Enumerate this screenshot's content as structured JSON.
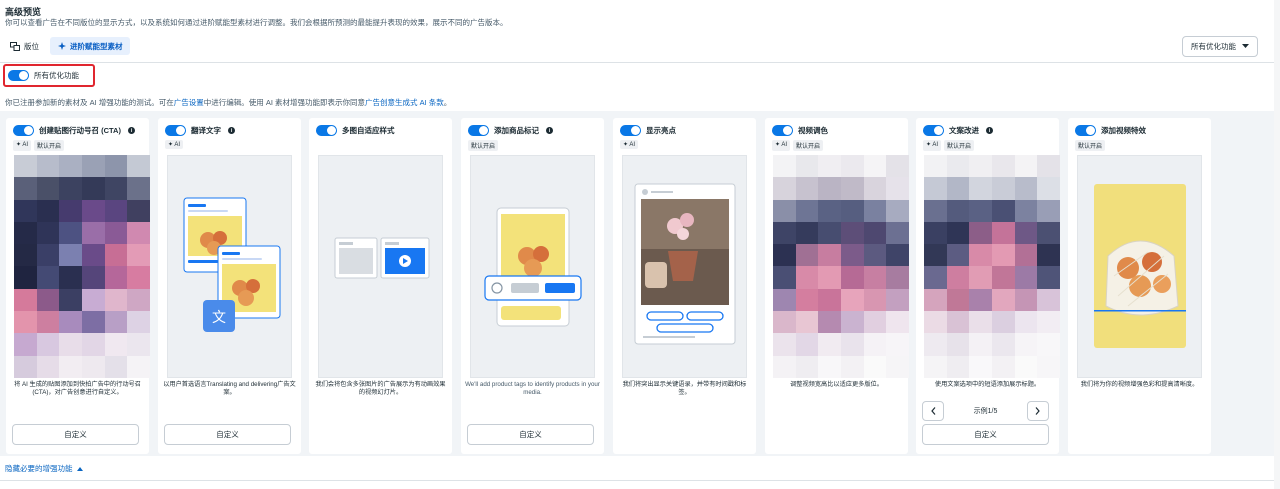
{
  "header": {
    "title": "高级预览",
    "subtitle": "你可以查看广告在不同版位的显示方式，以及系统如何通过进阶赋能型素材进行调整。我们会根据所预测的最能提升表现的效果，展示不同的广告版本。"
  },
  "tabs": [
    {
      "label": "版位",
      "icon": "placements-icon"
    },
    {
      "label": "进阶赋能型素材",
      "icon": "sparkle-icon"
    }
  ],
  "all_opt_dropdown": {
    "label": "所有优化功能",
    "icon": "caret-down-icon"
  },
  "master_toggle": {
    "label": "所有优化功能",
    "on": true
  },
  "notice": {
    "part1": "你已注册参加新的素材及 AI 增强功能的测试。可在",
    "link1": "广告设置",
    "part2": "中进行编辑。使用 AI 素材增强功能即表示你同意",
    "link2": "广告创意生成式 AI 条款",
    "part3": "。"
  },
  "colors": {
    "accent": "#0a78e6",
    "highlight_border": "#e0262f",
    "panel_bg": "#f1f4f7",
    "link": "#0a66c2"
  },
  "cards": [
    {
      "title": "创建贴图行动号召 (CTA)",
      "info": "i",
      "badges": [
        "AI",
        "默认开启"
      ],
      "desc": "将 AI 生成的贴图添加到快拍广告中的行动号召 (CTA)，对广告创意进行自定义。",
      "button": "自定义"
    },
    {
      "title": "翻译文字",
      "info": "i",
      "badges": [
        "AI"
      ],
      "desc": "以用户首选语言Translating and delivering广告文案。",
      "button": "自定义"
    },
    {
      "title": "多图自适应样式",
      "info": "",
      "badges": [],
      "desc": "我们会将包含多张图片的广告展示为有动画效果的视频幻灯片。",
      "button": ""
    },
    {
      "title": "添加商品标记",
      "info": "i",
      "badges": [
        "默认开启"
      ],
      "desc": "We'll add product tags to identify products in your media.",
      "button": "自定义"
    },
    {
      "title": "显示亮点",
      "info": "",
      "badges": [
        "AI"
      ],
      "desc": "我们将突出显示关键语录，并带有时间戳和标签。",
      "button": ""
    },
    {
      "title": "视频调色",
      "info": "",
      "badges": [
        "AI",
        "默认开启"
      ],
      "desc": "调整视频宽高比以适应更多版位。",
      "button": ""
    },
    {
      "title": "文案改进",
      "info": "i",
      "badges": [
        "AI",
        "默认开启"
      ],
      "desc": "使用文案选项中的短语添加展示标题。",
      "button": "自定义",
      "pager": "示例1/5"
    },
    {
      "title": "添加视频特效",
      "info": "",
      "badges": [
        "默认开启"
      ],
      "desc": "我们将为你的视频增强色彩和提高清晰度。",
      "button": ""
    }
  ],
  "footer": {
    "hide_link": "隐藏必要的增强功能"
  }
}
